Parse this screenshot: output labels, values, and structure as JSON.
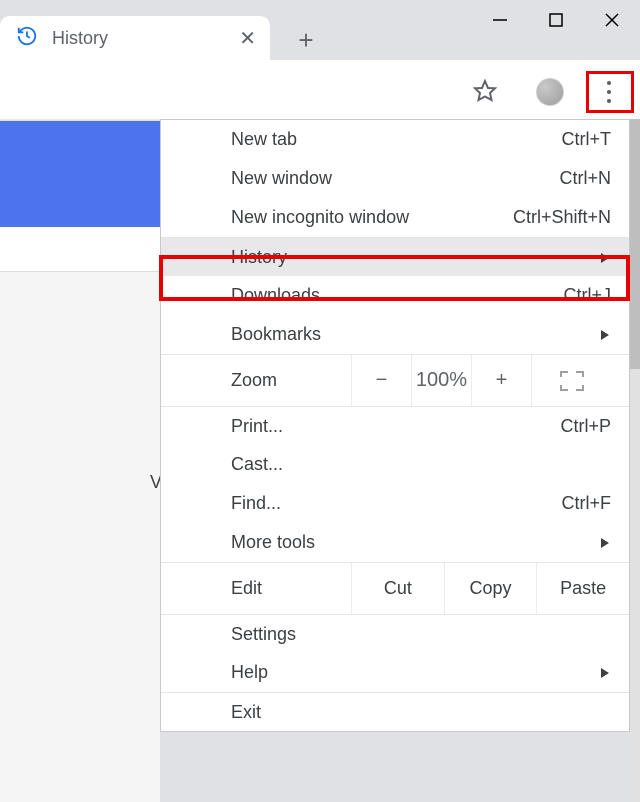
{
  "tab": {
    "title": "History"
  },
  "menu": {
    "new_tab": {
      "label": "New tab",
      "shortcut": "Ctrl+T"
    },
    "new_window": {
      "label": "New window",
      "shortcut": "Ctrl+N"
    },
    "new_incognito": {
      "label": "New incognito window",
      "shortcut": "Ctrl+Shift+N"
    },
    "history": {
      "label": "History"
    },
    "downloads": {
      "label": "Downloads",
      "shortcut": "Ctrl+J"
    },
    "bookmarks": {
      "label": "Bookmarks"
    },
    "zoom": {
      "label": "Zoom",
      "value": "100%",
      "minus": "−",
      "plus": "+"
    },
    "print": {
      "label": "Print...",
      "shortcut": "Ctrl+P"
    },
    "cast": {
      "label": "Cast..."
    },
    "find": {
      "label": "Find...",
      "shortcut": "Ctrl+F"
    },
    "more_tools": {
      "label": "More tools"
    },
    "edit": {
      "label": "Edit",
      "cut": "Cut",
      "copy": "Copy",
      "paste": "Paste"
    },
    "settings": {
      "label": "Settings"
    },
    "help": {
      "label": "Help"
    },
    "exit": {
      "label": "Exit"
    }
  }
}
